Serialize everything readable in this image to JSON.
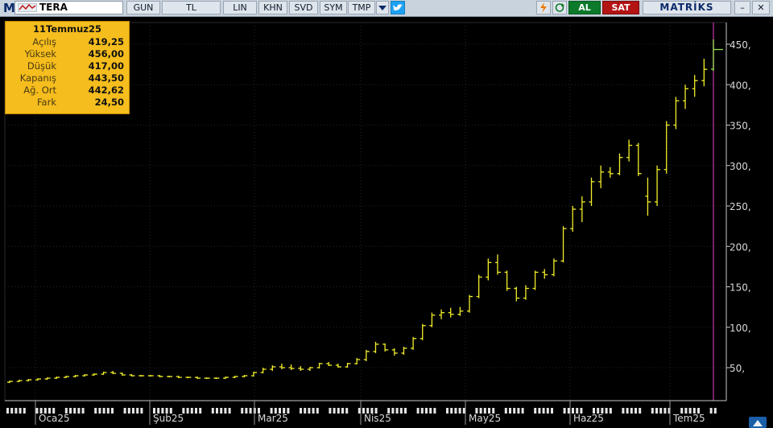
{
  "toolbar": {
    "logo": "M",
    "symbol": "TERA",
    "buttons": [
      "GUN",
      "TL",
      "LIN",
      "KHN",
      "SVD",
      "SYM",
      "TMP"
    ],
    "al_label": "AL",
    "sat_label": "SAT",
    "brand": "MATRİKS",
    "minimize": "–",
    "close": "✕",
    "accent_green": "#0c7a2a",
    "accent_red": "#b31414"
  },
  "info_box": {
    "date": "11Temmuz25",
    "rows": [
      {
        "label": "Açılış",
        "value": "419,25"
      },
      {
        "label": "Yüksek",
        "value": "456,00"
      },
      {
        "label": "Düşük",
        "value": "417,00"
      },
      {
        "label": "Kapanış",
        "value": "443,50"
      },
      {
        "label": "Ağ. Ort",
        "value": "442,62"
      },
      {
        "label": "Fark",
        "value": "24,50"
      }
    ]
  },
  "chart_data": {
    "type": "ohlc",
    "series_color": "#f2ee2a",
    "y_axis": {
      "ticks": [
        50,
        100,
        150,
        200,
        250,
        300,
        350,
        400,
        450
      ],
      "tick_labels": [
        "50,",
        "100,",
        "150,",
        "200,",
        "250,",
        "300,",
        "350,",
        "400,",
        "450,"
      ],
      "range": [
        0,
        465
      ]
    },
    "x_axis": {
      "tick_labels": [
        "Oca25",
        "Şub25",
        "Mar25",
        "Nis25",
        "May25",
        "Haz25",
        "Tem25"
      ]
    },
    "grid": true,
    "cursor_date": "11Temmuz25",
    "bars": [
      {
        "o": 32,
        "h": 34,
        "l": 31,
        "c": 33
      },
      {
        "o": 33,
        "h": 35,
        "l": 32,
        "c": 34
      },
      {
        "o": 34,
        "h": 36,
        "l": 33,
        "c": 35
      },
      {
        "o": 35,
        "h": 37,
        "l": 34,
        "c": 36
      },
      {
        "o": 36,
        "h": 38,
        "l": 35,
        "c": 37
      },
      {
        "o": 37,
        "h": 39,
        "l": 36,
        "c": 38
      },
      {
        "o": 38,
        "h": 40,
        "l": 37,
        "c": 39
      },
      {
        "o": 39,
        "h": 41,
        "l": 38,
        "c": 40
      },
      {
        "o": 40,
        "h": 42,
        "l": 39,
        "c": 41
      },
      {
        "o": 41,
        "h": 43,
        "l": 40,
        "c": 42
      },
      {
        "o": 42,
        "h": 45,
        "l": 41,
        "c": 44
      },
      {
        "o": 44,
        "h": 46,
        "l": 42,
        "c": 43
      },
      {
        "o": 43,
        "h": 44,
        "l": 40,
        "c": 41
      },
      {
        "o": 41,
        "h": 42,
        "l": 39,
        "c": 40
      },
      {
        "o": 40,
        "h": 41,
        "l": 39,
        "c": 40
      },
      {
        "o": 40,
        "h": 41,
        "l": 39,
        "c": 40
      },
      {
        "o": 40,
        "h": 41,
        "l": 38,
        "c": 39
      },
      {
        "o": 39,
        "h": 40,
        "l": 38,
        "c": 39
      },
      {
        "o": 39,
        "h": 40,
        "l": 37,
        "c": 38
      },
      {
        "o": 38,
        "h": 39,
        "l": 37,
        "c": 38
      },
      {
        "o": 38,
        "h": 39,
        "l": 36,
        "c": 37
      },
      {
        "o": 37,
        "h": 38,
        "l": 36,
        "c": 37
      },
      {
        "o": 37,
        "h": 38,
        "l": 36,
        "c": 37
      },
      {
        "o": 37,
        "h": 39,
        "l": 36,
        "c": 38
      },
      {
        "o": 38,
        "h": 40,
        "l": 37,
        "c": 39
      },
      {
        "o": 39,
        "h": 41,
        "l": 38,
        "c": 40
      },
      {
        "o": 40,
        "h": 45,
        "l": 39,
        "c": 44
      },
      {
        "o": 44,
        "h": 50,
        "l": 43,
        "c": 48
      },
      {
        "o": 48,
        "h": 53,
        "l": 46,
        "c": 51
      },
      {
        "o": 51,
        "h": 55,
        "l": 48,
        "c": 50
      },
      {
        "o": 50,
        "h": 54,
        "l": 47,
        "c": 49
      },
      {
        "o": 49,
        "h": 52,
        "l": 46,
        "c": 48
      },
      {
        "o": 48,
        "h": 51,
        "l": 46,
        "c": 50
      },
      {
        "o": 50,
        "h": 56,
        "l": 49,
        "c": 55
      },
      {
        "o": 55,
        "h": 57,
        "l": 52,
        "c": 53
      },
      {
        "o": 53,
        "h": 55,
        "l": 50,
        "c": 51
      },
      {
        "o": 51,
        "h": 56,
        "l": 50,
        "c": 55
      },
      {
        "o": 55,
        "h": 62,
        "l": 54,
        "c": 60
      },
      {
        "o": 60,
        "h": 72,
        "l": 58,
        "c": 70
      },
      {
        "o": 70,
        "h": 82,
        "l": 68,
        "c": 79
      },
      {
        "o": 79,
        "h": 80,
        "l": 70,
        "c": 72
      },
      {
        "o": 72,
        "h": 74,
        "l": 65,
        "c": 68
      },
      {
        "o": 68,
        "h": 76,
        "l": 66,
        "c": 74
      },
      {
        "o": 74,
        "h": 88,
        "l": 72,
        "c": 86
      },
      {
        "o": 86,
        "h": 104,
        "l": 84,
        "c": 102
      },
      {
        "o": 102,
        "h": 118,
        "l": 100,
        "c": 115
      },
      {
        "o": 115,
        "h": 122,
        "l": 110,
        "c": 118
      },
      {
        "o": 118,
        "h": 124,
        "l": 112,
        "c": 116
      },
      {
        "o": 116,
        "h": 125,
        "l": 114,
        "c": 120
      },
      {
        "o": 120,
        "h": 140,
        "l": 118,
        "c": 138
      },
      {
        "o": 138,
        "h": 165,
        "l": 136,
        "c": 162
      },
      {
        "o": 162,
        "h": 185,
        "l": 158,
        "c": 180
      },
      {
        "o": 180,
        "h": 190,
        "l": 165,
        "c": 168
      },
      {
        "o": 168,
        "h": 170,
        "l": 145,
        "c": 148
      },
      {
        "o": 148,
        "h": 150,
        "l": 132,
        "c": 136
      },
      {
        "o": 136,
        "h": 152,
        "l": 134,
        "c": 148
      },
      {
        "o": 148,
        "h": 170,
        "l": 146,
        "c": 168
      },
      {
        "o": 168,
        "h": 172,
        "l": 160,
        "c": 165
      },
      {
        "o": 165,
        "h": 185,
        "l": 163,
        "c": 182
      },
      {
        "o": 182,
        "h": 225,
        "l": 180,
        "c": 222
      },
      {
        "o": 222,
        "h": 250,
        "l": 218,
        "c": 246
      },
      {
        "o": 246,
        "h": 262,
        "l": 230,
        "c": 255
      },
      {
        "o": 255,
        "h": 285,
        "l": 250,
        "c": 280
      },
      {
        "o": 280,
        "h": 300,
        "l": 272,
        "c": 292
      },
      {
        "o": 292,
        "h": 298,
        "l": 285,
        "c": 290
      },
      {
        "o": 290,
        "h": 315,
        "l": 288,
        "c": 310
      },
      {
        "o": 310,
        "h": 332,
        "l": 305,
        "c": 325
      },
      {
        "o": 325,
        "h": 328,
        "l": 287,
        "c": 290
      },
      {
        "o": 262,
        "h": 285,
        "l": 238,
        "c": 255
      },
      {
        "o": 255,
        "h": 300,
        "l": 250,
        "c": 295
      },
      {
        "o": 295,
        "h": 355,
        "l": 290,
        "c": 350
      },
      {
        "o": 350,
        "h": 385,
        "l": 345,
        "c": 380
      },
      {
        "o": 380,
        "h": 400,
        "l": 370,
        "c": 395
      },
      {
        "o": 395,
        "h": 412,
        "l": 385,
        "c": 405
      },
      {
        "o": 405,
        "h": 432,
        "l": 398,
        "c": 419
      },
      {
        "o": 419.25,
        "h": 456,
        "l": 417,
        "c": 443.5
      }
    ]
  }
}
